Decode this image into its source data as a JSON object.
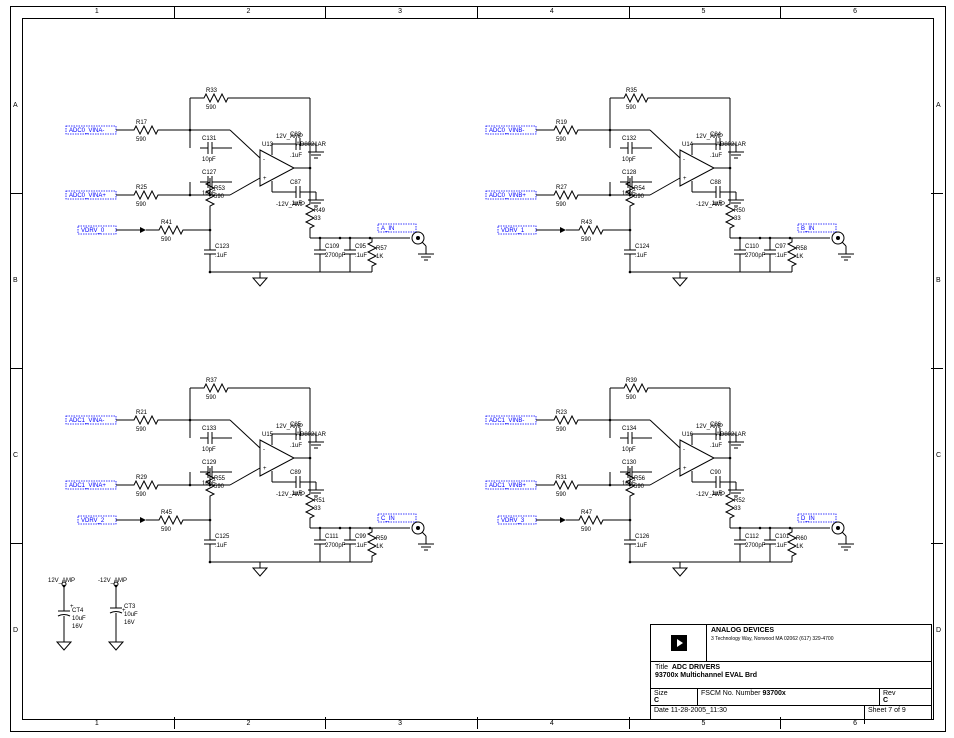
{
  "frame": {
    "cols": [
      "1",
      "2",
      "3",
      "4",
      "5",
      "6"
    ],
    "rows": [
      "A",
      "B",
      "C",
      "D"
    ]
  },
  "channels": [
    {
      "name": "0",
      "in1": "ADC0_VINA-",
      "in2": "ADC0_VINA+",
      "in3": "VDRV_0",
      "out": "A_IN",
      "R_top": {
        "ref": "R33",
        "val": "590"
      },
      "R_in1": {
        "ref": "R17",
        "val": "590"
      },
      "R_mid": {
        "ref": "R53",
        "val": "590"
      },
      "R_in2": {
        "ref": "R25",
        "val": "590"
      },
      "R_in3": {
        "ref": "R41",
        "val": "590"
      },
      "R_out": {
        "ref": "R49",
        "val": "33"
      },
      "R_load": {
        "ref": "R57",
        "val": "1K"
      },
      "C_in_top": {
        "ref": "C131",
        "val": "10pF"
      },
      "C_in_bot": {
        "ref": "C127",
        "val": "10pF"
      },
      "C_drv": {
        "ref": "C123",
        "val": ".1uF"
      },
      "C_out": {
        "ref": "C109",
        "val": "2700pF"
      },
      "C_ref": {
        "ref": "C95",
        "val": ".1uF"
      },
      "U": {
        "ref": "U13",
        "part": "AD8021AR",
        "supply_p": "12V_AMP",
        "supply_n": "-12V_AMP",
        "dec_p": {
          "ref": "C83",
          "val": ".1uF"
        },
        "dec_n": {
          "ref": "C87",
          "val": ".1uF"
        }
      }
    },
    {
      "name": "1",
      "in1": "ADC0_VINB-",
      "in2": "ADC0_VINB+",
      "in3": "VDRV_1",
      "out": "B_IN",
      "R_top": {
        "ref": "R35",
        "val": "590"
      },
      "R_in1": {
        "ref": "R19",
        "val": "590"
      },
      "R_mid": {
        "ref": "R54",
        "val": "590"
      },
      "R_in2": {
        "ref": "R27",
        "val": "590"
      },
      "R_in3": {
        "ref": "R43",
        "val": "590"
      },
      "R_out": {
        "ref": "R50",
        "val": "33"
      },
      "R_load": {
        "ref": "R58",
        "val": "1K"
      },
      "C_in_top": {
        "ref": "C132",
        "val": "10pF"
      },
      "C_in_bot": {
        "ref": "C128",
        "val": "10pF"
      },
      "C_drv": {
        "ref": "C124",
        "val": ".1uF"
      },
      "C_out": {
        "ref": "C110",
        "val": "2700pF"
      },
      "C_ref": {
        "ref": "C97",
        "val": ".1uF"
      },
      "U": {
        "ref": "U14",
        "part": "AD8021AR",
        "supply_p": "12V_AMP",
        "supply_n": "-12V_AMP",
        "dec_p": {
          "ref": "C84",
          "val": ".1uF"
        },
        "dec_n": {
          "ref": "C88",
          "val": ".1uF"
        }
      }
    },
    {
      "name": "2",
      "in1": "ADC1_VINA-",
      "in2": "ADC1_VINA+",
      "in3": "VDRV_2",
      "out": "C_IN",
      "R_top": {
        "ref": "R37",
        "val": "590"
      },
      "R_in1": {
        "ref": "R21",
        "val": "590"
      },
      "R_mid": {
        "ref": "R55",
        "val": "590"
      },
      "R_in2": {
        "ref": "R29",
        "val": "590"
      },
      "R_in3": {
        "ref": "R45",
        "val": "590"
      },
      "R_out": {
        "ref": "R51",
        "val": "33"
      },
      "R_load": {
        "ref": "R59",
        "val": "1K"
      },
      "C_in_top": {
        "ref": "C133",
        "val": "10pF"
      },
      "C_in_bot": {
        "ref": "C129",
        "val": "10pF"
      },
      "C_drv": {
        "ref": "C125",
        "val": ".1uF"
      },
      "C_out": {
        "ref": "C111",
        "val": "2700pF"
      },
      "C_ref": {
        "ref": "C99",
        "val": ".1uF"
      },
      "U": {
        "ref": "U15",
        "part": "AD8021AR",
        "supply_p": "12V_AMP",
        "supply_n": "-12V_AMP",
        "dec_p": {
          "ref": "C85",
          "val": ".1uF"
        },
        "dec_n": {
          "ref": "C89",
          "val": ".1uF"
        }
      }
    },
    {
      "name": "3",
      "in1": "ADC1_VINB-",
      "in2": "ADC1_VINB+",
      "in3": "VDRV_3",
      "out": "D_IN",
      "R_top": {
        "ref": "R39",
        "val": "590"
      },
      "R_in1": {
        "ref": "R23",
        "val": "590"
      },
      "R_mid": {
        "ref": "R56",
        "val": "590"
      },
      "R_in2": {
        "ref": "R31",
        "val": "590"
      },
      "R_in3": {
        "ref": "R47",
        "val": "590"
      },
      "R_out": {
        "ref": "R52",
        "val": "33"
      },
      "R_load": {
        "ref": "R60",
        "val": "1K"
      },
      "C_in_top": {
        "ref": "C134",
        "val": "10pF"
      },
      "C_in_bot": {
        "ref": "C130",
        "val": "10pF"
      },
      "C_drv": {
        "ref": "C126",
        "val": ".1uF"
      },
      "C_out": {
        "ref": "C112",
        "val": "2700pF"
      },
      "C_ref": {
        "ref": "C101",
        "val": ".1uF"
      },
      "U": {
        "ref": "U16",
        "part": "AD8021AR",
        "supply_p": "12V_AMP",
        "supply_n": "-12V_AMP",
        "dec_p": {
          "ref": "C86",
          "val": ".1uF"
        },
        "dec_n": {
          "ref": "C90",
          "val": ".1uF"
        }
      }
    }
  ],
  "bulk": {
    "rail_p": "12V_AMP",
    "rail_n": "-12V_AMP",
    "Cp": {
      "ref": "CT4",
      "val": "10uF",
      "volt": "16V"
    },
    "Cn": {
      "ref": "CT3",
      "val": "10uF",
      "volt": "16V"
    }
  },
  "titleblock": {
    "company": "ANALOG\nDEVICES",
    "addr": "3 Technology Way, Norwood MA 02062\n(617) 329-4700",
    "title": "ADC DRIVERS\n93700x Multichannel EVAL Brd",
    "size": "C",
    "number": "93700x",
    "rev": "C",
    "date": "11-28-2005_11:30",
    "sheet": "7 of 9"
  }
}
